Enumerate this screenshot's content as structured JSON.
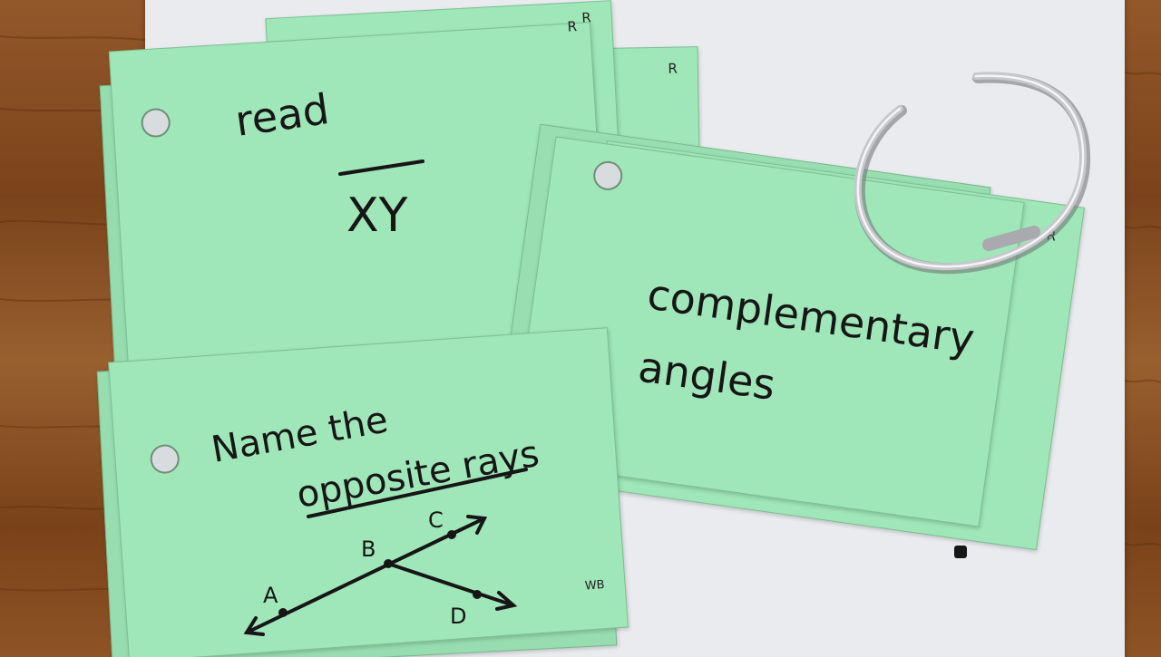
{
  "scene": {
    "palette": {
      "wood": "#8a4f22",
      "paper": "#e9ebef",
      "card": "#9fe6b8",
      "ink": "#161616",
      "ring": "#b9b9bd"
    }
  },
  "cards": {
    "top_left": {
      "word": "read",
      "segment": "XY",
      "corner": "R"
    },
    "top_left_back": {
      "corner_a": "R",
      "corner_b": "R"
    },
    "right": {
      "line1": "complementary",
      "line2": "angles",
      "corner": "R"
    },
    "bottom_left": {
      "line1": "Name the",
      "line2": "opposite rays",
      "points": [
        "A",
        "B",
        "C",
        "D"
      ],
      "corner": "WB"
    }
  },
  "ring": {
    "icon": "binder-ring-icon"
  }
}
